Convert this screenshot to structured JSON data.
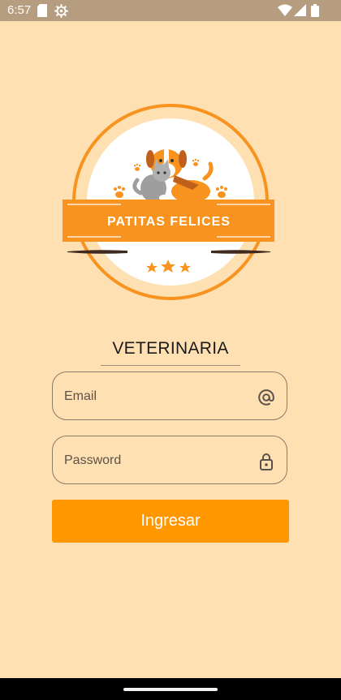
{
  "status_bar": {
    "time": "6:57",
    "icons": [
      "sd-card-icon",
      "settings-gear-icon",
      "wifi-icon",
      "cellular-signal-icon",
      "battery-icon"
    ]
  },
  "logo": {
    "brand_name": "PATITAS FELICES",
    "colors": {
      "accent": "#F7931E",
      "ring": "#F7931E",
      "ribbon": "#F7931E",
      "background": "#FFE0B2"
    }
  },
  "login": {
    "subtitle": "VETERINARIA",
    "email_placeholder": "Email",
    "password_placeholder": "Password",
    "submit_label": "Ingresar"
  },
  "colors": {
    "background": "#FFE0B2",
    "button": "#FF9800",
    "status_bar": "#B69D80"
  }
}
